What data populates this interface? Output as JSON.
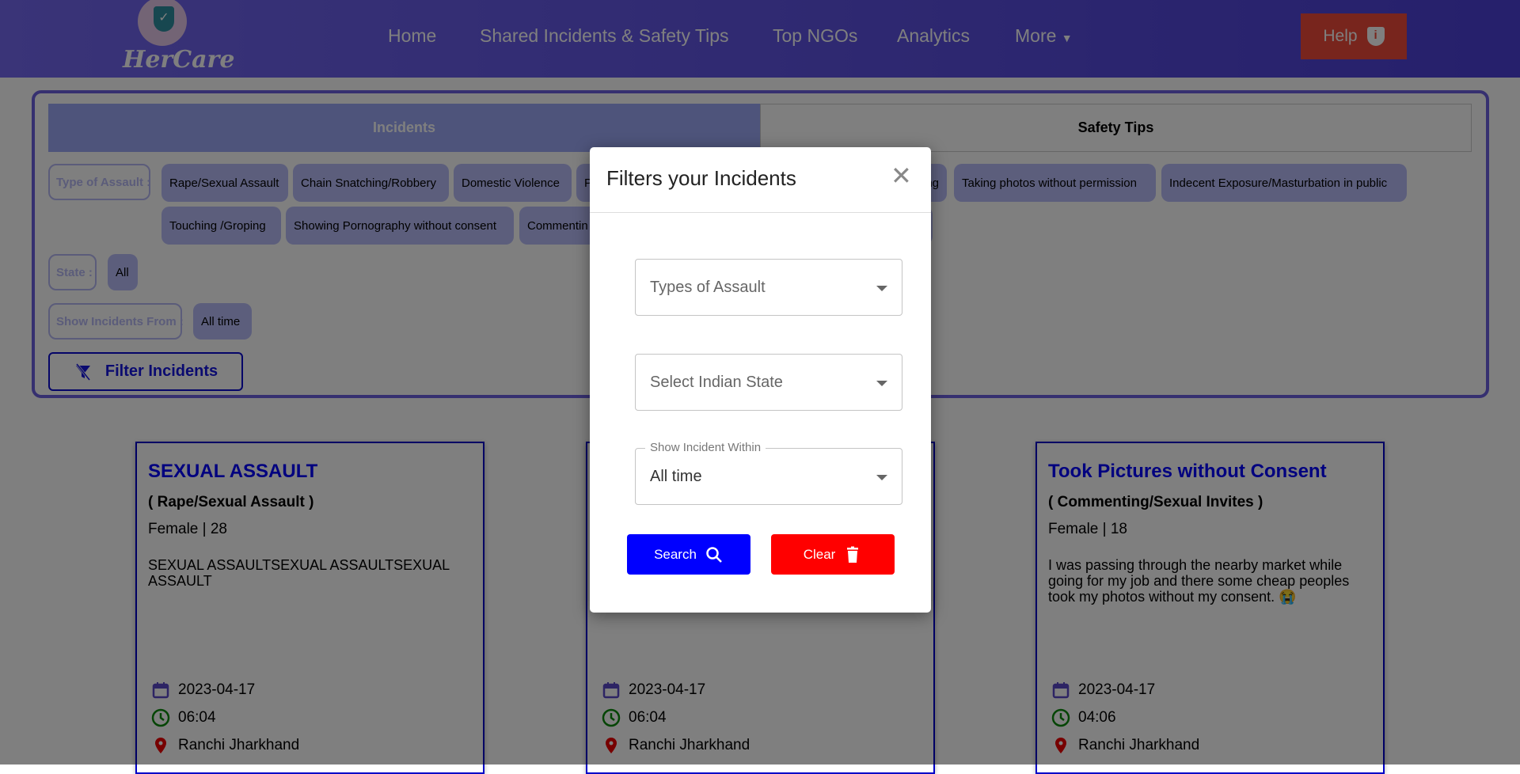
{
  "brand": {
    "name": "HerCare"
  },
  "nav": {
    "items": [
      "Home",
      "Shared Incidents & Safety Tips",
      "Top NGOs",
      "Analytics",
      "More"
    ],
    "help": "Help"
  },
  "tabs": {
    "incidents": "Incidents",
    "safety": "Safety Tips"
  },
  "filters": {
    "type_label": "Type of Assault :",
    "chips_row1": [
      "Rape/Sexual Assault",
      "Chain Snatching/Robbery",
      "Domestic Violence",
      "P",
      "ng",
      "Taking photos without permission",
      "Indecent Exposure/Masturbation in public"
    ],
    "chips_row2": [
      "Touching /Groping",
      "Showing Pornography without consent",
      "Commentin"
    ],
    "state_label": "State :",
    "state_value": "All",
    "from_label": "Show Incidents From :",
    "from_value": "All time",
    "filter_button": "Filter Incidents"
  },
  "cards": [
    {
      "title": "SEXUAL ASSAULT",
      "subtitle": "( Rape/Sexual Assault )",
      "meta": "Female | 28",
      "desc": "SEXUAL ASSAULTSEXUAL ASSAULTSEXUAL ASSAULT",
      "date": "2023-04-17",
      "time": "06:04",
      "location": "Ranchi Jharkhand"
    },
    {
      "date": "2023-04-17",
      "time": "06:04",
      "location": "Ranchi Jharkhand"
    },
    {
      "title": "Took Pictures without Consent",
      "subtitle": "( Commenting/Sexual Invites )",
      "meta": "Female | 18",
      "desc": "I was passing through the nearby market while going for my job and there some cheap peoples took my photos without my consent. 😭",
      "date": "2023-04-17",
      "time": "04:06",
      "location": "Ranchi Jharkhand"
    }
  ],
  "modal": {
    "title": "Filters your Incidents",
    "assault_placeholder": "Types of Assault",
    "state_placeholder": "Select Indian State",
    "within_label": "Show Incident Within",
    "within_value": "All time",
    "search": "Search",
    "clear": "Clear"
  },
  "colors": {
    "search": "#0000ff",
    "clear": "#ff0000",
    "help": "#f04a3a",
    "card_title": "#0000ff"
  }
}
